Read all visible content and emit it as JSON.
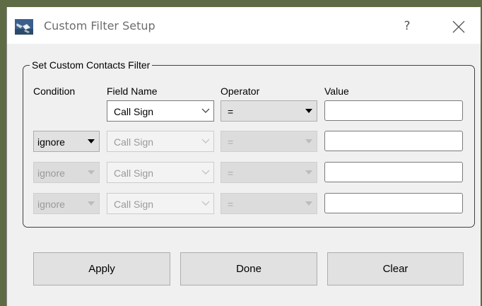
{
  "window": {
    "title": "Custom Filter Setup",
    "help_label": "?"
  },
  "group": {
    "legend": "Set Custom Contacts Filter",
    "headers": {
      "condition": "Condition",
      "field_name": "Field Name",
      "operator": "Operator",
      "value": "Value"
    }
  },
  "rows": [
    {
      "condition": "",
      "field": "Call Sign",
      "operator": "=",
      "value": ""
    },
    {
      "condition": "ignore",
      "field": "Call Sign",
      "operator": "=",
      "value": ""
    },
    {
      "condition": "ignore",
      "field": "Call Sign",
      "operator": "=",
      "value": ""
    },
    {
      "condition": "ignore",
      "field": "Call Sign",
      "operator": "=",
      "value": ""
    }
  ],
  "buttons": {
    "apply": "Apply",
    "done": "Done",
    "clear": "Clear"
  },
  "colors": {
    "dialog_bg": "#f0f0f0",
    "titlebar_bg": "#ffffff",
    "button_bg": "#e1e1e1",
    "disabled_text": "#9a9a9a"
  },
  "icons": {
    "app": "satellite-icon",
    "close": "close-icon",
    "help": "help-icon",
    "dropdown": "chevron-down-icon",
    "dropdown_solid": "triangle-down-icon"
  }
}
